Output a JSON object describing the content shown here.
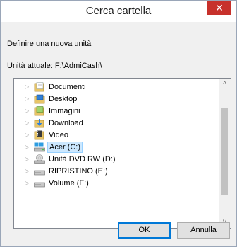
{
  "window": {
    "title": "Cerca cartella",
    "close_glyph": "✕"
  },
  "dialog": {
    "instruction": "Definire una nuova unità",
    "current_label": "Unità attuale: F:\\AdmiCash\\"
  },
  "tree": {
    "items": [
      {
        "label": "Documenti",
        "icon": "documents-folder-icon",
        "selected": false
      },
      {
        "label": "Desktop",
        "icon": "desktop-folder-icon",
        "selected": false
      },
      {
        "label": "Immagini",
        "icon": "pictures-folder-icon",
        "selected": false
      },
      {
        "label": "Download",
        "icon": "downloads-folder-icon",
        "selected": false
      },
      {
        "label": "Video",
        "icon": "videos-folder-icon",
        "selected": false
      },
      {
        "label": "Acer (C:)",
        "icon": "system-drive-icon",
        "selected": true
      },
      {
        "label": "Unità DVD RW (D:)",
        "icon": "dvd-drive-icon",
        "selected": false
      },
      {
        "label": "RIPRISTINO (E:)",
        "icon": "hard-drive-icon",
        "selected": false
      },
      {
        "label": "Volume (F:)",
        "icon": "hard-drive-icon",
        "selected": false
      }
    ],
    "expand_glyph": "▷"
  },
  "scrollbar": {
    "up_glyph": "^",
    "down_glyph": "v"
  },
  "buttons": {
    "ok_label": "OK",
    "cancel_label": "Annulla"
  },
  "colors": {
    "selection_bg": "#cce8ff",
    "close_red": "#c7312b",
    "accent": "#0078d7"
  }
}
